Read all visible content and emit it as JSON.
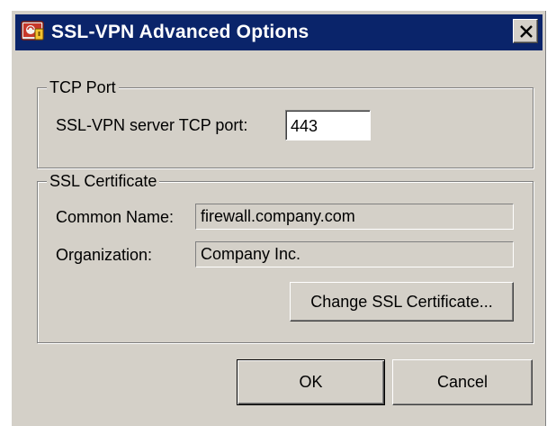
{
  "window": {
    "title": "SSL-VPN Advanced Options",
    "icon": "app-icon",
    "close_icon": "close-icon"
  },
  "tcp_port_group": {
    "label": "TCP Port",
    "port_label": "SSL-VPN server TCP port:",
    "port_value": "443"
  },
  "ssl_cert_group": {
    "label": "SSL Certificate",
    "common_name_label": "Common Name:",
    "common_name_value": "firewall.company.com",
    "organization_label": "Organization:",
    "organization_value": "Company Inc.",
    "change_button_label": "Change SSL Certificate..."
  },
  "footer": {
    "ok_label": "OK",
    "cancel_label": "Cancel"
  },
  "colors": {
    "titlebar": "#0a246a",
    "dialog_face": "#d4d0c8"
  }
}
